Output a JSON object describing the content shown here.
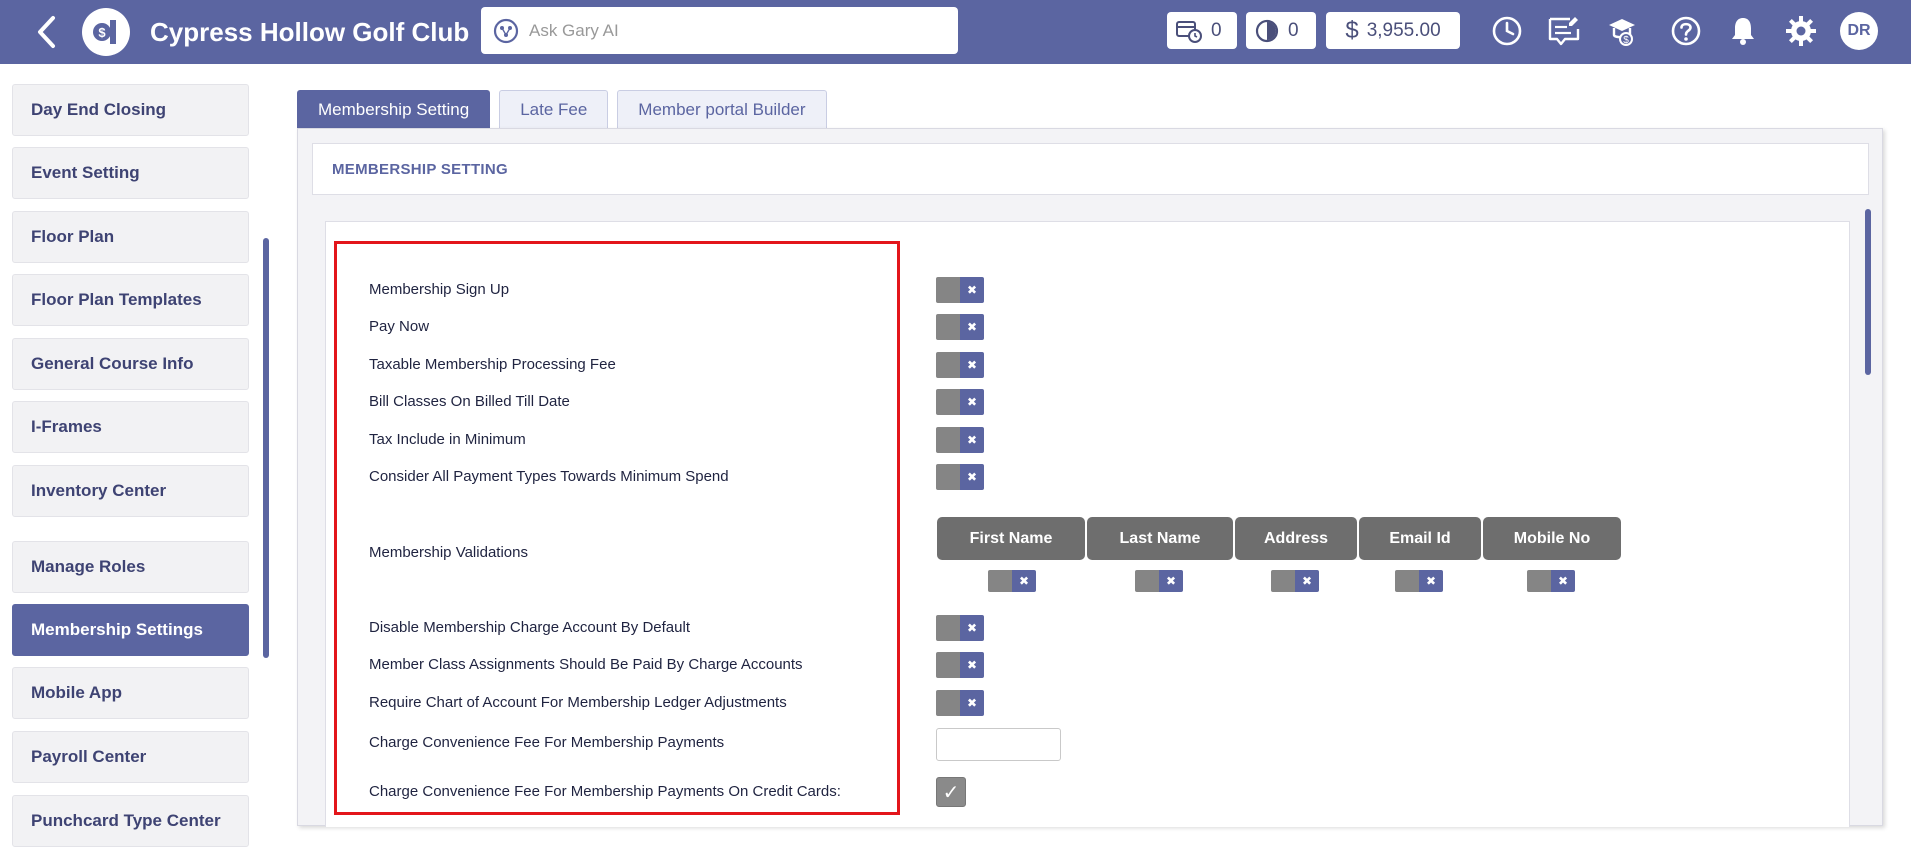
{
  "header": {
    "title": "Cypress Hollow Golf Club",
    "search_placeholder": "Ask Gary AI",
    "counter_one": "0",
    "counter_two": "0",
    "balance": "3,955.00",
    "avatar_initials": "DR"
  },
  "sidebar": {
    "items": [
      "Day End Closing",
      "Event Setting",
      "Floor Plan",
      "Floor Plan Templates",
      "General Course Info",
      "I-Frames",
      "Inventory Center",
      "Manage Roles",
      "Membership Settings",
      "Mobile App",
      "Payroll Center",
      "Punchcard Type Center"
    ],
    "active": "Membership Settings"
  },
  "tabs": [
    "Membership Setting",
    "Late Fee",
    "Member portal Builder"
  ],
  "section_title": "MEMBERSHIP SETTING",
  "settings": {
    "membership_sign_up": "Membership Sign Up",
    "pay_now": "Pay Now",
    "taxable_fee": "Taxable Membership Processing Fee",
    "bill_classes": "Bill Classes On Billed Till Date",
    "tax_include": "Tax Include in Minimum",
    "consider_all_payment": "Consider All Payment Types Towards Minimum Spend",
    "membership_validations": "Membership Validations",
    "disable_charge_account": "Disable Membership Charge Account By Default",
    "member_class_assignments": "Member Class Assignments Should Be Paid By Charge Accounts",
    "require_chart_of_account": "Require Chart of Account For Membership Ledger Adjustments",
    "charge_convenience_fee": "Charge Convenience Fee For Membership Payments",
    "charge_convenience_fee_cc": "Charge Convenience Fee For Membership Payments On Credit Cards:"
  },
  "validation_columns": [
    "First Name",
    "Last Name",
    "Address",
    "Email Id",
    "Mobile No"
  ],
  "toggle_off_glyph": "✖",
  "checkbox_glyph": "✓",
  "colors": {
    "brand": "#5b65a1",
    "highlight": "#e3161b",
    "toggle_knob": "#858585",
    "validation_header": "#6e6e6e"
  }
}
